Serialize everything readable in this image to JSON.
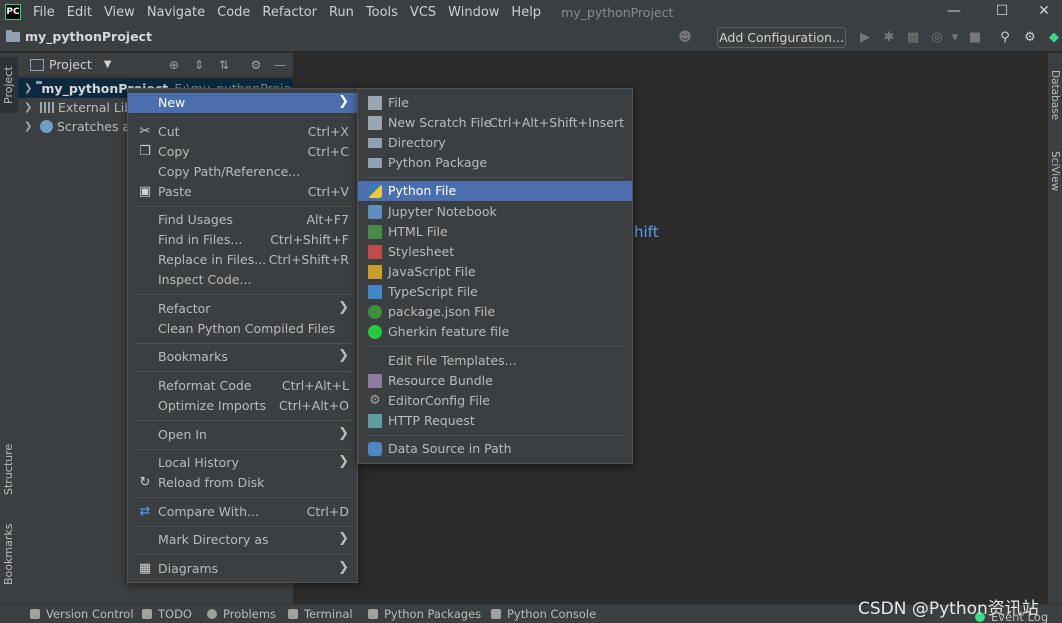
{
  "menubar": {
    "logo": "PC",
    "items": [
      "File",
      "Edit",
      "View",
      "Navigate",
      "Code",
      "Refactor",
      "Run",
      "Tools",
      "VCS",
      "Window",
      "Help"
    ],
    "title": "my_pythonProject",
    "controls": [
      "—",
      "☐",
      "✕"
    ]
  },
  "navbar": {
    "project": "my_pythonProject",
    "add_config": "Add Configuration..."
  },
  "left_strip": {
    "project": "Project",
    "structure": "Structure",
    "bookmarks": "Bookmarks"
  },
  "right_strip": {
    "database": "Database",
    "sciview": "SciView"
  },
  "project_panel": {
    "title": "Project",
    "rows": [
      {
        "label": "my_pythonProject",
        "path": "E:\\my_pythonProject"
      },
      {
        "label": "External Libraries"
      },
      {
        "label": "Scratches and Consoles"
      }
    ]
  },
  "editor": {
    "hint_fragment": "hift"
  },
  "context_menu": {
    "items": [
      {
        "label": "New",
        "shortcut": "",
        "submenu": true
      },
      {
        "label": "Cut",
        "shortcut": "Ctrl+X"
      },
      {
        "label": "Copy",
        "shortcut": "Ctrl+C"
      },
      {
        "label": "Copy Path/Reference...",
        "shortcut": ""
      },
      {
        "label": "Paste",
        "shortcut": "Ctrl+V"
      },
      {
        "label": "Find Usages",
        "shortcut": "Alt+F7"
      },
      {
        "label": "Find in Files...",
        "shortcut": "Ctrl+Shift+F"
      },
      {
        "label": "Replace in Files...",
        "shortcut": "Ctrl+Shift+R"
      },
      {
        "label": "Inspect Code...",
        "shortcut": ""
      },
      {
        "label": "Refactor",
        "shortcut": "",
        "submenu": true
      },
      {
        "label": "Clean Python Compiled Files",
        "shortcut": ""
      },
      {
        "label": "Bookmarks",
        "shortcut": "",
        "submenu": true
      },
      {
        "label": "Reformat Code",
        "shortcut": "Ctrl+Alt+L"
      },
      {
        "label": "Optimize Imports",
        "shortcut": "Ctrl+Alt+O"
      },
      {
        "label": "Open In",
        "shortcut": "",
        "submenu": true
      },
      {
        "label": "Local History",
        "shortcut": "",
        "submenu": true
      },
      {
        "label": "Reload from Disk",
        "shortcut": ""
      },
      {
        "label": "Compare With...",
        "shortcut": "Ctrl+D"
      },
      {
        "label": "Mark Directory as",
        "shortcut": "",
        "submenu": true
      },
      {
        "label": "Diagrams",
        "shortcut": "",
        "submenu": true
      }
    ]
  },
  "new_submenu": {
    "items": [
      {
        "label": "File",
        "shortcut": ""
      },
      {
        "label": "New Scratch File",
        "shortcut": "Ctrl+Alt+Shift+Insert"
      },
      {
        "label": "Directory",
        "shortcut": ""
      },
      {
        "label": "Python Package",
        "shortcut": ""
      },
      {
        "label": "Python File",
        "shortcut": ""
      },
      {
        "label": "Jupyter Notebook",
        "shortcut": ""
      },
      {
        "label": "HTML File",
        "shortcut": ""
      },
      {
        "label": "Stylesheet",
        "shortcut": ""
      },
      {
        "label": "JavaScript File",
        "shortcut": ""
      },
      {
        "label": "TypeScript File",
        "shortcut": ""
      },
      {
        "label": "package.json File",
        "shortcut": ""
      },
      {
        "label": "Gherkin feature file",
        "shortcut": ""
      },
      {
        "label": "Edit File Templates...",
        "shortcut": ""
      },
      {
        "label": "Resource Bundle",
        "shortcut": ""
      },
      {
        "label": "EditorConfig File",
        "shortcut": ""
      },
      {
        "label": "HTTP Request",
        "shortcut": ""
      },
      {
        "label": "Data Source in Path",
        "shortcut": ""
      }
    ]
  },
  "statusbar": {
    "items": [
      "Version Control",
      "TODO",
      "Problems",
      "Terminal",
      "Python Packages",
      "Python Console"
    ],
    "right": "Event Log"
  },
  "watermark": "CSDN @Python资讯站"
}
